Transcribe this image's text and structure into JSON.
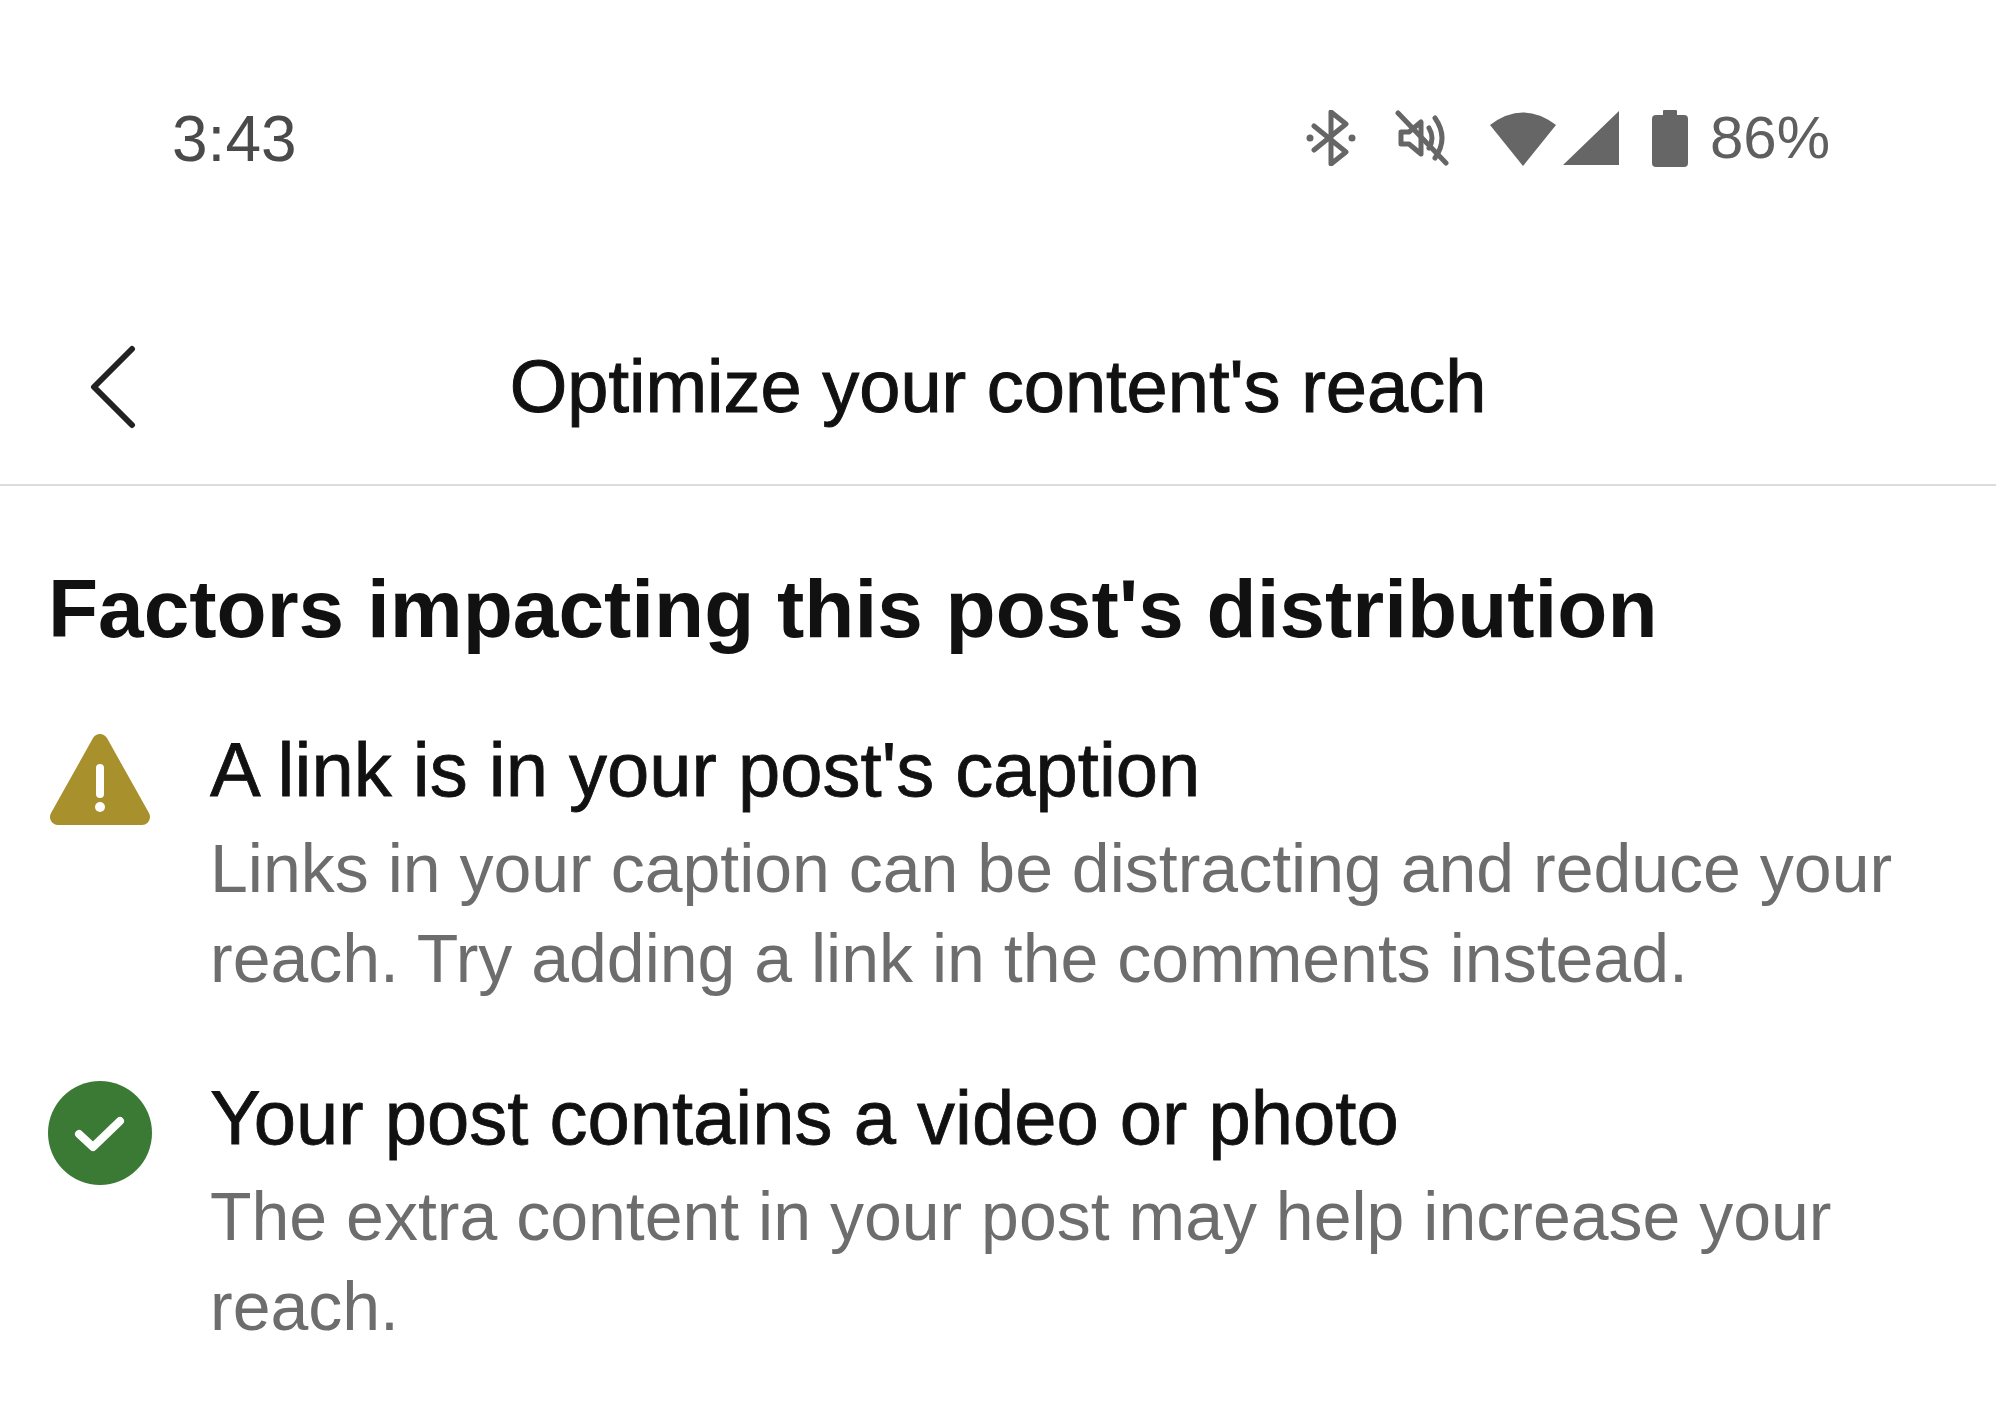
{
  "status_bar": {
    "time": "3:43",
    "battery": "86%"
  },
  "header": {
    "title": "Optimize your content's reach"
  },
  "section": {
    "heading": "Factors impacting this post's distribution",
    "factors": [
      {
        "kind": "warning",
        "title": "A link is in your post's caption",
        "description": "Links in your caption can be distracting and reduce your reach. Try adding a link in the comments instead."
      },
      {
        "kind": "positive",
        "title": "Your post contains a video or photo",
        "description": "The extra content in your post may help increase your reach."
      }
    ]
  }
}
